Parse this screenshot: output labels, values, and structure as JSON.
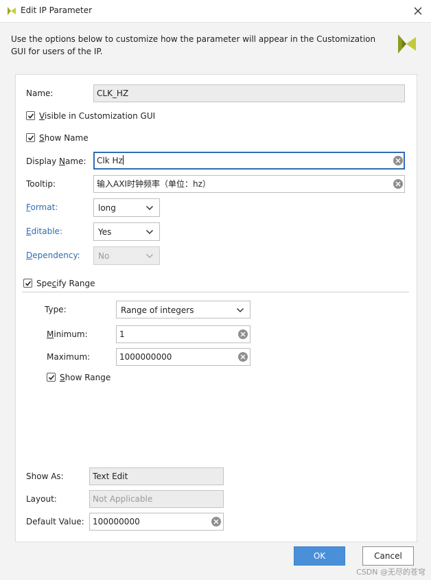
{
  "window": {
    "title": "Edit IP Parameter"
  },
  "intro_text": "Use the options below to customize how the parameter will appear in the Customization GUI for users of the IP.",
  "form": {
    "name": {
      "label": "Name:",
      "value": "CLK_HZ"
    },
    "visible_in_gui": {
      "label_pre": "",
      "label_ul": "V",
      "label_post": "isible in Customization GUI",
      "checked": true
    },
    "show_name": {
      "label_pre": "",
      "label_ul": "S",
      "label_post": "how Name",
      "checked": true
    },
    "display_name": {
      "label_pre": "Display ",
      "label_ul": "N",
      "label_post": "ame:",
      "value": "Clk Hz"
    },
    "tooltip": {
      "label": "Tooltip:",
      "value": "输入AXI时钟频率（单位：hz）"
    },
    "format": {
      "label_pre": "",
      "label_ul": "F",
      "label_post": "ormat:",
      "value": "long"
    },
    "editable": {
      "label_pre": "",
      "label_ul": "E",
      "label_post": "ditable:",
      "value": "Yes"
    },
    "dependency": {
      "label_pre": "",
      "label_ul": "D",
      "label_post": "ependency:",
      "value": "No"
    },
    "specify_range": {
      "label_pre": "Spe",
      "label_ul": "c",
      "label_post": "ify Range",
      "checked": true
    },
    "range": {
      "type": {
        "label": "Type:",
        "value": "Range of integers"
      },
      "minimum": {
        "label_pre": "",
        "label_ul": "M",
        "label_post": "inimum:",
        "value": "1"
      },
      "maximum": {
        "label": "Maximum:",
        "value": "1000000000"
      },
      "show_range": {
        "label_pre": "",
        "label_ul": "S",
        "label_post": "how Range",
        "checked": true
      }
    },
    "show_as": {
      "label": "Show As:",
      "value": "Text Edit"
    },
    "layout": {
      "label": "Layout:",
      "value": "Not Applicable"
    },
    "default_value": {
      "label": "Default Value:",
      "value": "100000000"
    }
  },
  "buttons": {
    "ok": "OK",
    "cancel": "Cancel"
  },
  "watermark": "CSDN @无尽的苍穹",
  "colors": {
    "accent": "#2f6bb5",
    "ok_button": "#4a90d9",
    "logo": "#9aa82a"
  }
}
